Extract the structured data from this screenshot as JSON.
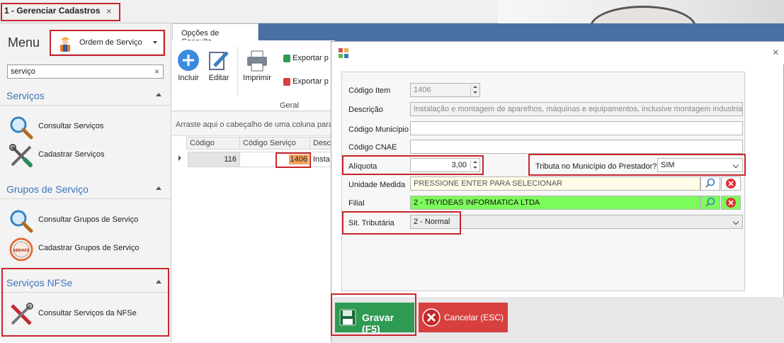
{
  "window": {
    "tab_title": "1 - Gerenciar Cadastros",
    "tab_close": "×"
  },
  "sidebar": {
    "menu_label": "Menu",
    "module_select": "Ordem de Serviço",
    "search_value": "serviço",
    "search_clear": "×",
    "sections": [
      {
        "title": "Serviços",
        "items": [
          "Consultar Serviços",
          "Cadastrar Serviços"
        ]
      },
      {
        "title": "Grupos de Serviço",
        "items": [
          "Consultar Grupos de Serviço",
          "Cadastrar Grupos de Serviço"
        ]
      },
      {
        "title": "Serviços NFSe",
        "items": [
          "Consultar Serviços da NFSe"
        ]
      }
    ],
    "service_badge": "SERVICE"
  },
  "ribbon": {
    "tab": "Opções de Consulta",
    "buttons": {
      "add": "Incluir",
      "edit": "Editar",
      "print": "Imprimir",
      "export1": "Exportar p",
      "export2": "Exportar p"
    },
    "group": "Geral"
  },
  "grid": {
    "drag_hint": "Arraste aqui o cabeçalho de uma coluna para",
    "columns": [
      "Código",
      "Código Serviço",
      "Desc"
    ],
    "row": {
      "codigo": "116",
      "codigo_servico": "1406",
      "descricao": "Insta"
    }
  },
  "dialog": {
    "close": "×",
    "labels": {
      "codigo_item": "Código Item",
      "descricao": "Descrição",
      "codigo_municipio": "Código Município",
      "codigo_cnae": "Código CNAE",
      "aliquota": "Alíquota",
      "tributa": "Tributa no Município do Prestador?",
      "unidade_medida": "Unidade Medida",
      "filial": "Filial",
      "sit_tributaria": "Sit. Tributária"
    },
    "values": {
      "codigo_item": "1406",
      "descricao": "Instalação e montagem de aparelhos, máquinas e equipamentos, inclusive montagem industria...",
      "codigo_municipio": "",
      "codigo_cnae": "",
      "aliquota": "3,00",
      "tributa": "SIM",
      "unidade_medida": "PRESSIONE ENTER PARA SELECIONAR",
      "filial": "2 - TRYIDEAS INFORMATICA LTDA",
      "sit_tributaria": "2 - Normal"
    },
    "buttons": {
      "save": "Gravar (F5)",
      "cancel": "Cancelar (ESC)"
    }
  },
  "colors": {
    "accent_blue": "#3b74b9",
    "highlight_red": "#c9262e",
    "save_green": "#2e9a52",
    "cancel_red": "#d84040",
    "filial_green": "#7cfc5a",
    "unidade_yellow": "#fffbe6",
    "selected_cell": "#f4a460"
  }
}
